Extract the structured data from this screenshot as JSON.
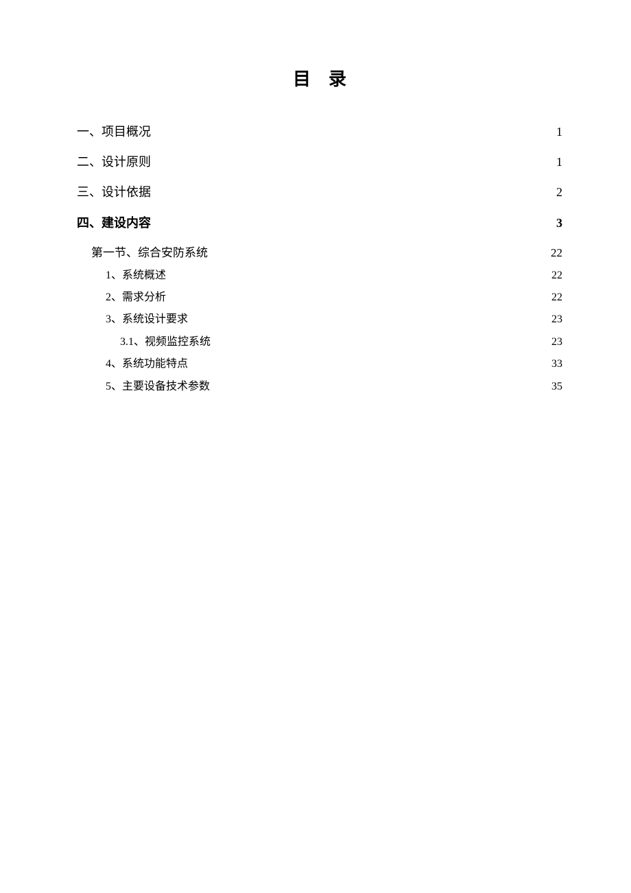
{
  "title": "目录",
  "toc": [
    {
      "level": 0,
      "label": "一、项目概况",
      "page": "1",
      "bold": false,
      "dots": "normal"
    },
    {
      "level": 0,
      "label": "二、设计原则",
      "page": "1",
      "bold": false,
      "dots": "normal"
    },
    {
      "level": 0,
      "label": "三、设计依据",
      "page": "2",
      "bold": false,
      "dots": "normal"
    },
    {
      "level": 0,
      "label": "四、建设内容",
      "page": "3",
      "bold": true,
      "dots": "small"
    },
    {
      "level": 1,
      "label": "第一节、综合安防系统",
      "page": "22",
      "bold": false,
      "dots": "normal"
    },
    {
      "level": 2,
      "label": "1、系统概述",
      "page": "22",
      "bold": false,
      "dots": "normal"
    },
    {
      "level": 2,
      "label": "2、需求分析",
      "page": "22",
      "bold": false,
      "dots": "normal"
    },
    {
      "level": 2,
      "label": "3、系统设计要求",
      "page": "23",
      "bold": false,
      "dots": "normal"
    },
    {
      "level": 3,
      "label": "3.1、视频监控系统",
      "page": "23",
      "bold": false,
      "dots": "normal"
    },
    {
      "level": 2,
      "label": "4、系统功能特点",
      "page": "33",
      "bold": false,
      "dots": "normal"
    },
    {
      "level": 2,
      "label": "5、主要设备技术参数",
      "page": "35",
      "bold": false,
      "dots": "normal"
    }
  ]
}
